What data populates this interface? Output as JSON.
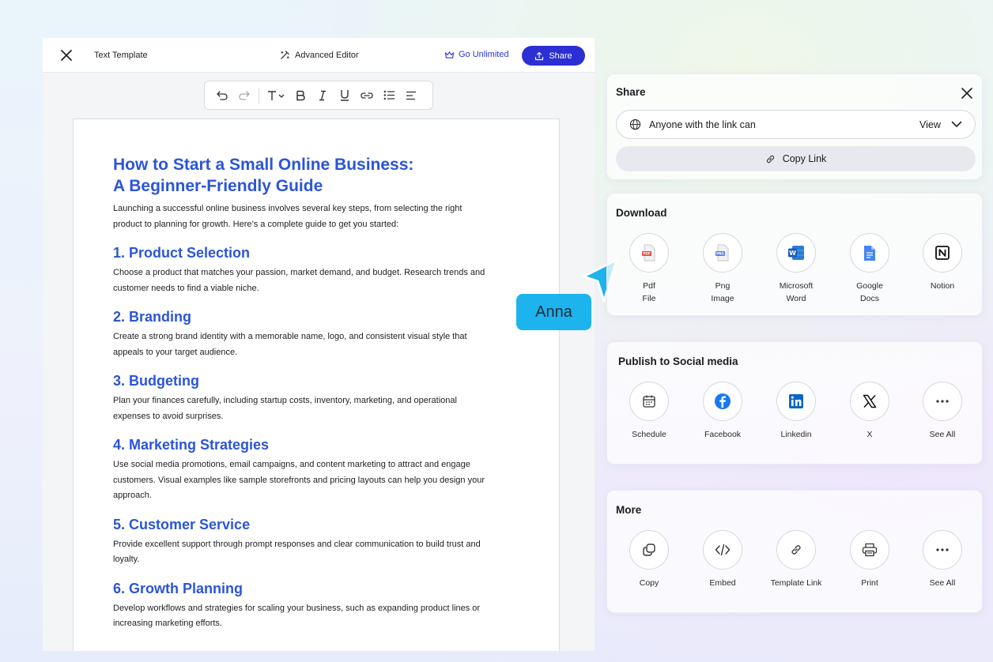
{
  "editor": {
    "doc_name": "Text Template",
    "advanced_editor": "Advanced Editor",
    "go_unlimited": "Go Unlimited",
    "share_label": "Share"
  },
  "document": {
    "title_line1": "How to Start a Small Online Business:",
    "title_line2": "A Beginner-Friendly Guide",
    "intro_line1": "Launching a successful online business involves several key steps, from selecting the right",
    "intro_line2": "product to planning for growth. Here’s a complete guide to get you started:",
    "sections": [
      {
        "heading": "1. Product Selection",
        "lines": [
          "Choose a product that matches your passion, market demand, and budget. Research trends and",
          "customer needs to find a viable niche."
        ]
      },
      {
        "heading": "2. Branding",
        "lines": [
          "Create a strong brand identity with a memorable name, logo, and consistent visual style that",
          "appeals to your target audience."
        ]
      },
      {
        "heading": "3. Budgeting",
        "lines": [
          "Plan your finances carefully, including startup costs, inventory, marketing, and operational",
          "expenses to avoid surprises."
        ]
      },
      {
        "heading": "4. Marketing Strategies",
        "lines": [
          "Use social media promotions, email campaigns, and content marketing to attract and engage",
          "customers. Visual examples like sample storefronts and pricing layouts can help you design your",
          "approach."
        ]
      },
      {
        "heading": "5. Customer Service",
        "lines": [
          "Provide excellent support through prompt responses and clear communication to build trust and",
          "loyalty."
        ]
      },
      {
        "heading": "6. Growth Planning",
        "lines": [
          "Develop workflows and strategies for scaling your business, such as expanding product lines or",
          "increasing marketing efforts."
        ]
      }
    ]
  },
  "collaborator": {
    "name": "Anna",
    "color": "#1db4ee"
  },
  "share_panel": {
    "title": "Share",
    "access_text": "Anyone with the link can",
    "access_level": "View",
    "copy_link": "Copy Link"
  },
  "download_panel": {
    "title": "Download",
    "items": [
      {
        "line1": "Pdf",
        "line2": "File",
        "icon": "pdf-file-icon"
      },
      {
        "line1": "Png",
        "line2": "Image",
        "icon": "png-image-icon"
      },
      {
        "line1": "Microsoft",
        "line2": "Word",
        "icon": "word-icon"
      },
      {
        "line1": "Google",
        "line2": "Docs",
        "icon": "google-docs-icon"
      },
      {
        "line1": "Notion",
        "line2": "",
        "icon": "notion-icon"
      }
    ]
  },
  "social_panel": {
    "title": "Publish to Social media",
    "items": [
      {
        "label": "Schedule",
        "icon": "calendar-icon"
      },
      {
        "label": "Facebook",
        "icon": "facebook-icon"
      },
      {
        "label": "Linkedin",
        "icon": "linkedin-icon"
      },
      {
        "label": "X",
        "icon": "x-icon"
      },
      {
        "label": "See All",
        "icon": "more-icon"
      }
    ]
  },
  "more_panel": {
    "title": "More",
    "items": [
      {
        "label": "Copy",
        "icon": "copy-icon"
      },
      {
        "label": "Embed",
        "icon": "code-icon"
      },
      {
        "label": "Template Link",
        "icon": "link-icon"
      },
      {
        "label": "Print",
        "icon": "printer-icon"
      },
      {
        "label": "See All",
        "icon": "more-icon"
      }
    ]
  },
  "colors": {
    "accent": "#2b2fd4",
    "heading": "#2b55d8"
  }
}
